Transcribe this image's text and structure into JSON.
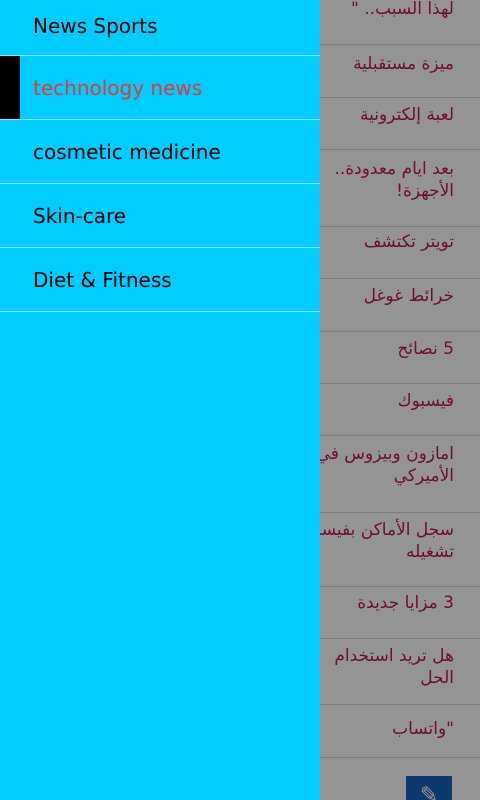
{
  "drawer": {
    "items": [
      {
        "label": "News Sports",
        "active": false
      },
      {
        "label": "technology news",
        "active": true
      },
      {
        "label": "cosmetic medicine",
        "active": false
      },
      {
        "label": "Skin-care",
        "active": false
      },
      {
        "label": "Diet & Fitness",
        "active": false
      }
    ]
  },
  "articles": [
    {
      "lines": [
        "لهذا السبب.. \""
      ]
    },
    {
      "lines": [
        "ميزة مستقبلية"
      ]
    },
    {
      "lines": [
        "لعبة إلكترونية"
      ]
    },
    {
      "lines": [
        "بعد ايام معدودة..",
        "الأجهزة!"
      ]
    },
    {
      "lines": [
        "تويتر تكتشف"
      ]
    },
    {
      "lines": [
        "خرائط غوغل"
      ]
    },
    {
      "lines": [
        "5 نصائح"
      ]
    },
    {
      "lines": [
        "فيسبوك"
      ]
    },
    {
      "lines": [
        "امازون وبيزوس في",
        "الأميركي"
      ]
    },
    {
      "lines": [
        "سجل الأماكن بفيسبوك",
        "تشغيله"
      ]
    },
    {
      "lines": [
        "3 مزايا جديدة"
      ]
    },
    {
      "lines": [
        "هل تريد استخدام",
        "الحل"
      ]
    },
    {
      "lines": [
        "\"واتساب"
      ]
    }
  ],
  "fab": {
    "icon": "edit-icon",
    "glyph": "✎"
  },
  "colors": {
    "drawer_bg": "#00ccff",
    "active_text": "#e53935",
    "article_text": "#c2185b"
  }
}
